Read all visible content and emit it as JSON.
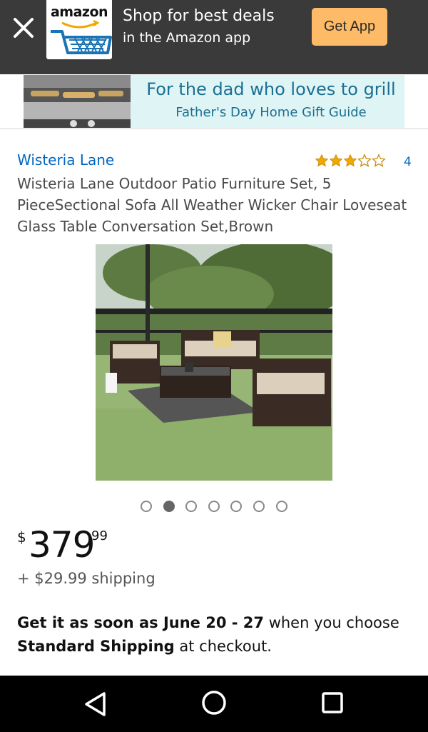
{
  "app_banner": {
    "logo_text": "amazon",
    "line1": "Shop for best deals",
    "line2": "in the Amazon app",
    "get_app_label": "Get App",
    "close_icon": "close-icon"
  },
  "ad_banner": {
    "title": "For the dad who loves to grill",
    "subtitle": "Father's Day Home Gift Guide"
  },
  "product": {
    "brand": "Wisteria Lane",
    "rating_stars": 3,
    "rating_max": 5,
    "rating_count": "4",
    "title": "Wisteria Lane Outdoor Patio Furniture Set, 5 PieceSectional Sofa All Weather Wicker Chair Loveseat Glass Table Conversation Set,Brown",
    "image_count": 7,
    "active_image": 2,
    "price_symbol": "$",
    "price_whole": "379",
    "price_fraction": "99",
    "shipping": "+ $29.99 shipping",
    "delivery_bold1": "Get it as soon as June 20 - 27",
    "delivery_text1": " when you choose",
    "delivery_bold2": "Standard Shipping",
    "delivery_text2": " at checkout."
  },
  "colors": {
    "banner_bg": "#3a3a3a",
    "get_app_bg": "#fdbb67",
    "link": "#0066c0",
    "star": "#f0a800"
  },
  "nav": {
    "back_icon": "back-triangle-icon",
    "home_icon": "home-circle-icon",
    "recent_icon": "recent-square-icon"
  }
}
